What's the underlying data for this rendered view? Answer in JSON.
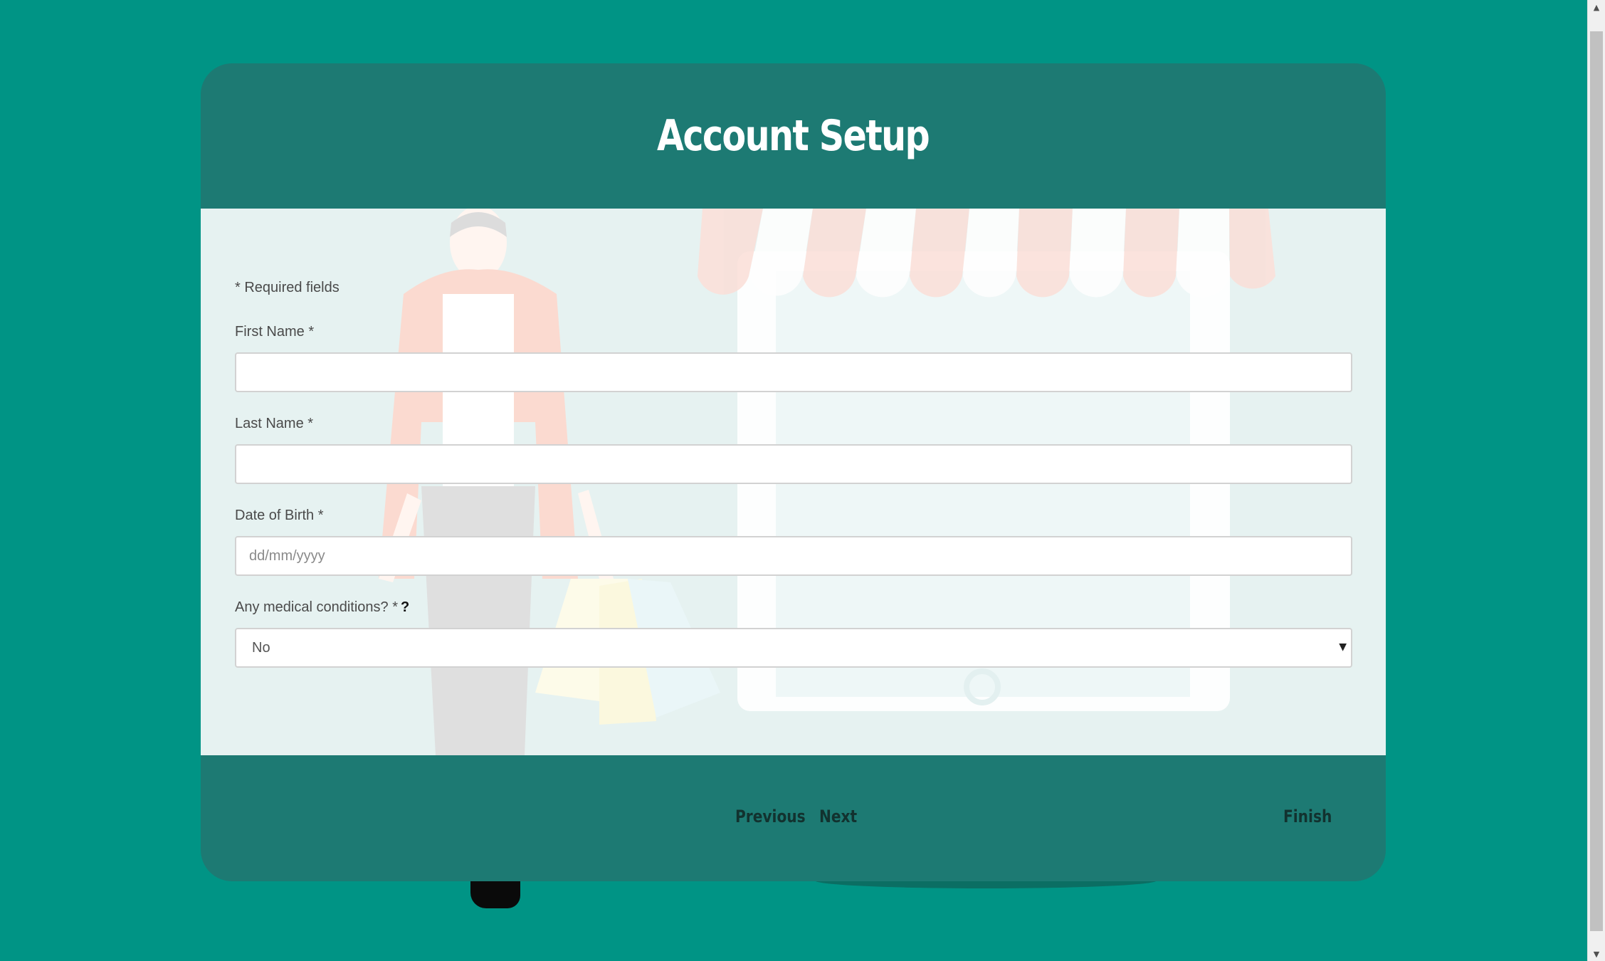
{
  "page": {
    "title": "Account Setup"
  },
  "form": {
    "required_note": "* Required fields",
    "first_name": {
      "label": "First Name *",
      "value": "",
      "placeholder": ""
    },
    "last_name": {
      "label": "Last Name *",
      "value": "",
      "placeholder": ""
    },
    "dob": {
      "label": "Date of Birth *",
      "value": "",
      "placeholder": "dd/mm/yyyy"
    },
    "medical": {
      "label": "Any medical conditions? *",
      "help": "?",
      "selected": "No"
    }
  },
  "footer": {
    "previous_label": "Previous",
    "next_label": "Next",
    "finish_label": "Finish"
  },
  "colors": {
    "background": "#009485",
    "card": "#1d7a73",
    "body": "#e6f2f1",
    "button_text": "#12322f"
  },
  "icons": {
    "select_chevron": "chevron-down-icon",
    "help": "question-icon"
  }
}
